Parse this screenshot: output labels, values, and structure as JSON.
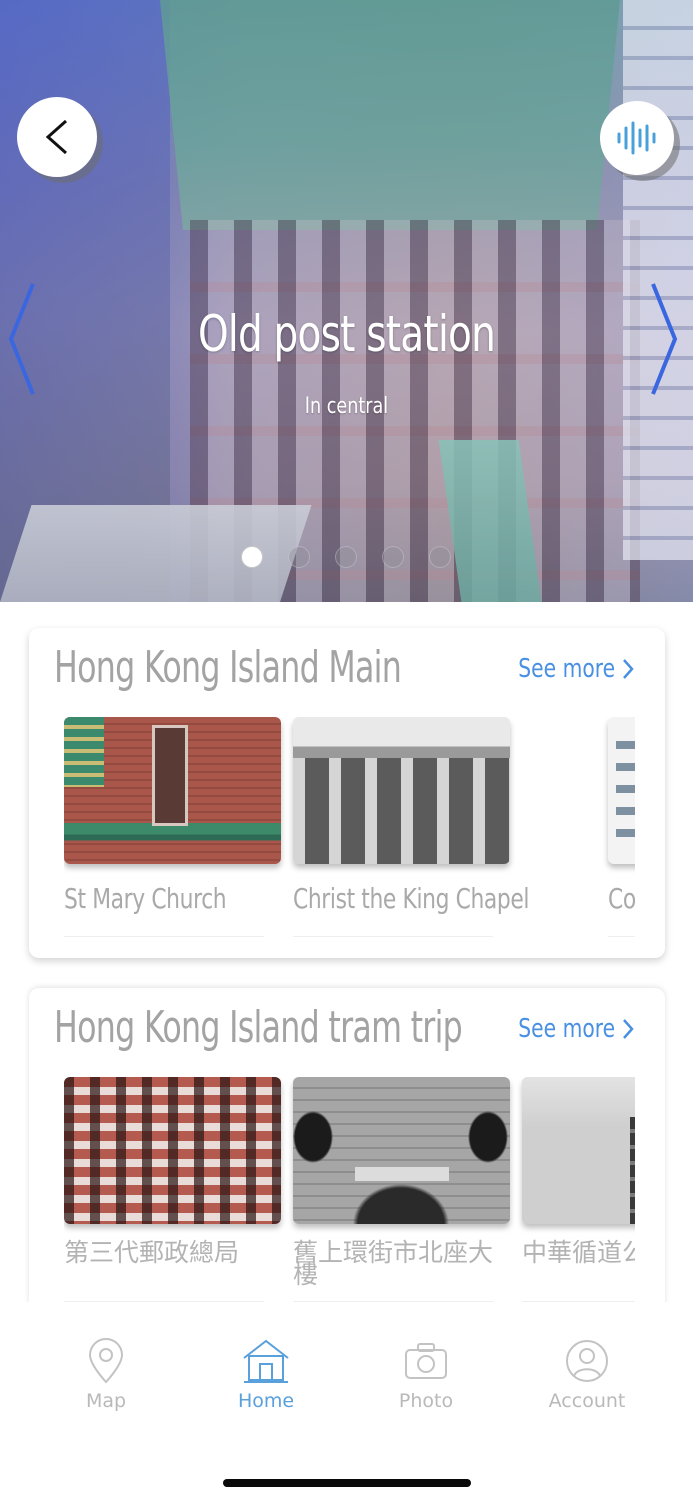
{
  "hero": {
    "title": "Old post station",
    "subtitle": "In central",
    "slide_count": 5,
    "active_slide": 1,
    "accent": "#3a67e0"
  },
  "sections": [
    {
      "title": "Hong Kong Island Main",
      "see_more": "See more",
      "items": [
        {
          "label": "St Mary Church"
        },
        {
          "label": "Christ the King Chapel"
        },
        {
          "label": "Confucius Hall"
        }
      ]
    },
    {
      "title": "Hong Kong Island tram trip",
      "see_more": "See more",
      "items": [
        {
          "label": "第三代郵政總局"
        },
        {
          "label": "舊上環街市北座大樓"
        },
        {
          "label": "中華循道公會堂"
        }
      ]
    }
  ],
  "tabbar": {
    "tabs": [
      {
        "label": "Map",
        "icon": "map-pin-icon"
      },
      {
        "label": "Home",
        "icon": "home-icon",
        "active": true
      },
      {
        "label": "Photo",
        "icon": "camera-icon"
      },
      {
        "label": "Account",
        "icon": "user-icon"
      }
    ]
  },
  "colors": {
    "link": "#4a90e2",
    "active_tab": "#5aa0db",
    "inactive_tab": "#b9b9b9",
    "section_title": "#a3a3a3"
  }
}
